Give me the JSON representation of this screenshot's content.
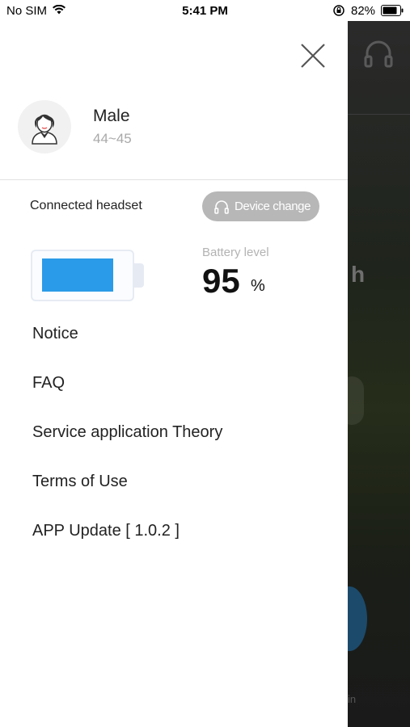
{
  "status_bar": {
    "carrier": "No SIM",
    "time": "5:41 PM",
    "battery_percent": "82%"
  },
  "profile": {
    "gender": "Male",
    "age_range": "44~45"
  },
  "headset": {
    "label": "Connected headset",
    "device_change_label": "Device change"
  },
  "battery": {
    "title": "Battery level",
    "value": "95",
    "unit": "%",
    "fill_fraction": 0.95,
    "fill_color": "#2a9be8"
  },
  "menu": {
    "notice": "Notice",
    "faq": "FAQ",
    "service_theory": "Service application Theory",
    "terms": "Terms of Use",
    "app_update": "APP Update [ 1.0.2 ]"
  },
  "background_app": {
    "partial_heading": "h",
    "partial_caption": "in"
  },
  "icons": {
    "close": "close-icon",
    "headphones": "headphones-icon",
    "avatar": "user-avatar-icon",
    "wifi": "wifi-icon",
    "orientation_lock": "orientation-lock-icon",
    "battery": "battery-icon"
  }
}
